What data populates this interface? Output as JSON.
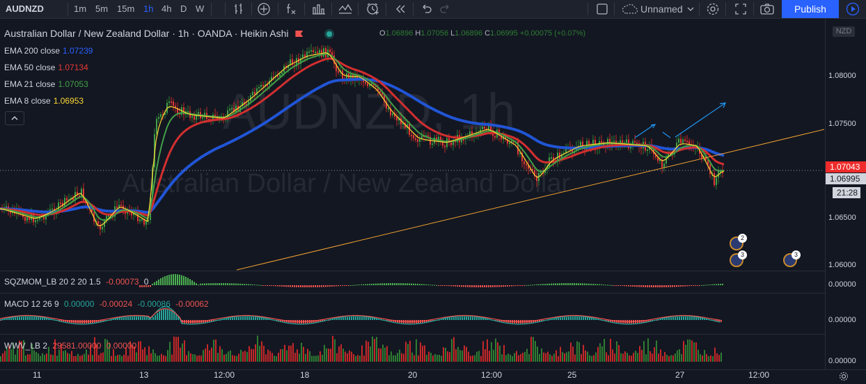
{
  "toolbar": {
    "symbol": "AUDNZD",
    "timeframes": [
      "1m",
      "5m",
      "15m",
      "1h",
      "4h",
      "D",
      "W"
    ],
    "active_timeframe": "1h",
    "layout_name": "Unnamed",
    "publish_label": "Publish",
    "icons": [
      "bar-style-icon",
      "add-indicator-icon",
      "fx-icon",
      "compare-icon",
      "alert-icon",
      "replay-icon",
      "undo-icon",
      "redo-icon",
      "fullscreen-checkbox-icon",
      "cloud-icon",
      "chevron-down-icon",
      "settings-icon",
      "expand-icon",
      "camera-icon",
      "play-icon"
    ]
  },
  "legend": {
    "title": "Australian Dollar / New Zealand Dollar · 1h · OANDA · Heikin Ashi",
    "ohlc": {
      "o_label": "O",
      "o": "1.06896",
      "h_label": "H",
      "h": "1.07056",
      "l_label": "L",
      "l": "1.06896",
      "c_label": "C",
      "c": "1.06995",
      "change": "+0.00075 (+0.07%)"
    },
    "indicators": [
      {
        "name": "EMA 200 close",
        "value": "1.07239",
        "color": "#2962ff"
      },
      {
        "name": "EMA 50 close",
        "value": "1.07134",
        "color": "#e53935"
      },
      {
        "name": "EMA 21 close",
        "value": "1.07053",
        "color": "#43a047"
      },
      {
        "name": "EMA 8 close",
        "value": "1.06953",
        "color": "#fdd835"
      }
    ]
  },
  "watermark": {
    "symbol_tf": "AUDNZD, 1h",
    "description": "Australian Dollar / New Zealand Dollar"
  },
  "price_scale": {
    "currency": "NZD",
    "ticks": [
      "1.08000",
      "1.07500",
      "1.07000",
      "1.06500",
      "1.06000"
    ],
    "last_price_red": "1.07043",
    "last_price": "1.06995",
    "countdown": "21:28"
  },
  "panes": {
    "sqzmom": {
      "legend": "SQZMOM_LB 20 2 20 1.5",
      "v1": "-0.00073",
      "v2": "0",
      "scale": "0.00000"
    },
    "macd": {
      "legend": "MACD 12 26 9",
      "v1": "0.00000",
      "v2": "-0.00024",
      "v3": "-0.00086",
      "v4": "-0.00062",
      "scale": "0.00000"
    },
    "wwv": {
      "legend": "WWV_LB 2",
      "v1": "29581.00000",
      "v2": "0.00000",
      "scale": "0.00000"
    }
  },
  "time_scale": {
    "labels": [
      "11",
      "13",
      "12:00",
      "18",
      "20",
      "12:00",
      "25",
      "27",
      "12:00"
    ]
  },
  "events": {
    "badge_a": "2",
    "badge_b": "3",
    "badge_c": "3"
  },
  "colors": {
    "accent": "#2962ff",
    "up": "#26a69a",
    "down": "#ef5350",
    "background": "#131722"
  }
}
